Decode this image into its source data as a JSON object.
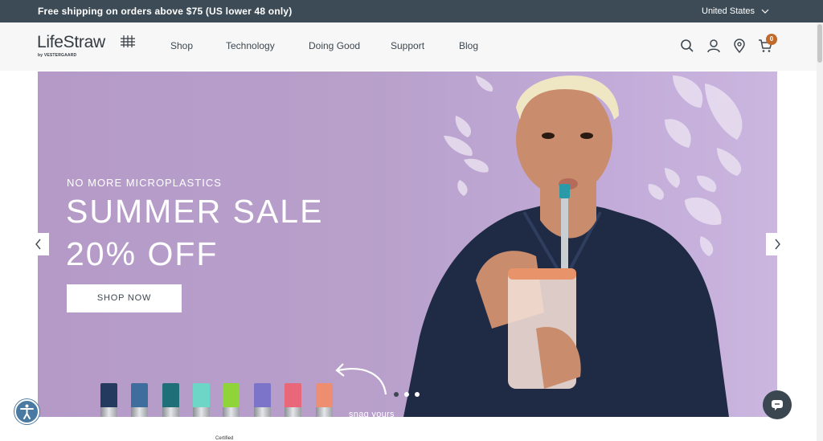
{
  "announcement": {
    "message": "Free shipping on orders above $75 (US lower 48 only)",
    "region": "United States"
  },
  "header": {
    "logo_text": "LifeStraw",
    "logo_sub": "by VESTERGAARD",
    "nav": [
      "Shop",
      "Technology",
      "Doing Good",
      "Support",
      "Blog"
    ],
    "cart_count": "0",
    "icons": [
      "search-icon",
      "account-icon",
      "location-pin-icon",
      "cart-icon"
    ]
  },
  "hero": {
    "eyebrow": "NO MORE MICROPLASTICS",
    "title_line1": "SUMMER SALE",
    "title_line2": "20% OFF",
    "cta": "SHOP NOW",
    "scroll_hint": "snag yours",
    "straw_colors": [
      "#243a5e",
      "#3f6d9e",
      "#1e6f78",
      "#6ed6c6",
      "#8fd53a",
      "#7c74c9",
      "#e8687a",
      "#ec8e6f"
    ],
    "slides": 3,
    "active_slide": 0
  },
  "footer_peek": {
    "certified": "Certified"
  },
  "colors": {
    "announcement_bg": "#3d4b56",
    "hero_bg": "#b8a0cb",
    "badge": "#c06a2b",
    "chat": "#3a4650",
    "a11y": "#4a7aa1"
  }
}
